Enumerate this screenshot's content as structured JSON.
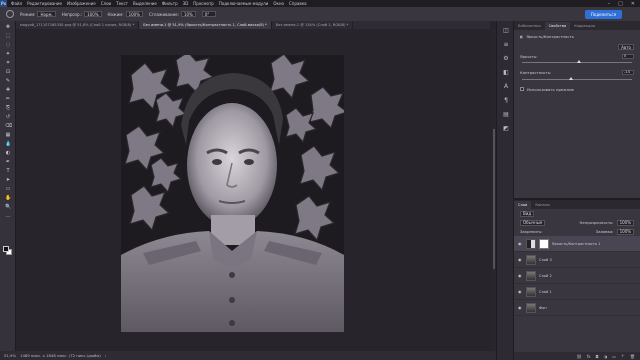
{
  "app": {
    "logo": "Ps"
  },
  "menu": [
    "Файл",
    "Редактирование",
    "Изображение",
    "Слои",
    "Текст",
    "Выделение",
    "Фильтр",
    "3D",
    "Просмотр",
    "Подключаемые модули",
    "Окно",
    "Справка"
  ],
  "window_controls": [
    "–",
    "□",
    "✕"
  ],
  "options_bar": {
    "mode_label": "Режим:",
    "mode_value": "Норм.",
    "opacity_label": "Непрозр.:",
    "opacity_value": "100%",
    "pressure_label": "Нажим:",
    "pressure_value": "100%",
    "smooth_label": "Сглаживание:",
    "smooth_value": "10%",
    "angle_value": "0°",
    "share_label": "Поделиться"
  },
  "tabs": [
    {
      "label": "модуий_171107165330.png @ 51,6% (Слой 1 копия, RGB/8) *",
      "active": false
    },
    {
      "label": "Без имени-1 @ 51,9% (Яркость/Контрастность 1, Слой-маска/8) *",
      "active": true
    },
    {
      "label": "Без имени-1 @ 134% (Слой 1, RGB/8) *",
      "active": false
    }
  ],
  "toolbar_icons": [
    "move-icon",
    "marquee-icon",
    "lasso-icon",
    "magic-wand-icon",
    "crop-icon",
    "frame-icon",
    "eyedropper-icon",
    "healing-icon",
    "brush-icon",
    "stamp-icon",
    "history-brush-icon",
    "eraser-icon",
    "gradient-icon",
    "blur-icon",
    "dodge-icon",
    "pen-icon",
    "type-icon",
    "path-select-icon",
    "shape-icon",
    "hand-icon",
    "zoom-icon",
    "more-icon"
  ],
  "toolbar_glyphs": [
    "✥",
    "⬚",
    "◌",
    "✦",
    "⌗",
    "⊡",
    "✎",
    "✚",
    "✏",
    "⎘",
    "↺",
    "⌫",
    "▦",
    "💧",
    "◐",
    "✒",
    "T",
    "➤",
    "▭",
    "✋",
    "🔍",
    "…"
  ],
  "status": {
    "zoom": "51,9%",
    "doc": "1489 пикс. x 1848 пикс. (72 пикс./дюйм)",
    "arrow": "›"
  },
  "dock_glyphs": [
    "◫",
    "≡",
    "⚙",
    "◧",
    "A",
    "¶",
    "▤",
    "◩"
  ],
  "properties": {
    "tabs": [
      "Библиотеки",
      "Свойства",
      "Коррекция"
    ],
    "active_tab": "Свойства",
    "header": "Яркость/Контрастность",
    "auto_label": "Авто",
    "brightness_label": "Яркость:",
    "brightness_value": "0",
    "brightness_level": 0.5,
    "contrast_label": "Контрастность:",
    "contrast_value": "-14",
    "contrast_level": 0.43,
    "legacy_label": "Использовать прежние"
  },
  "layers": {
    "tabs": [
      "Слои",
      "Каналы"
    ],
    "kind_label": "Вид",
    "blend_mode": "Обычные",
    "opacity_label": "Непрозрачность:",
    "opacity_value": "100%",
    "lock_label": "Закрепить:",
    "fill_label": "Заливка:",
    "fill_value": "100%",
    "items": [
      {
        "name": "Яркость/Контрастность 1",
        "type": "adj",
        "selected": true
      },
      {
        "name": "Слой 3",
        "type": "photo",
        "selected": false
      },
      {
        "name": "Слой 2",
        "type": "photo",
        "selected": false
      },
      {
        "name": "Слой 1",
        "type": "photo",
        "selected": false
      },
      {
        "name": "Фон",
        "type": "photo",
        "selected": false
      }
    ],
    "footer_icons": [
      "link-icon",
      "fx-icon",
      "mask-icon",
      "adjustment-icon",
      "folder-icon",
      "new-layer-icon",
      "trash-icon"
    ],
    "footer_glyphs": [
      "⛓",
      "fx",
      "◘",
      "◑",
      "▭",
      "＋",
      "🗑"
    ]
  }
}
